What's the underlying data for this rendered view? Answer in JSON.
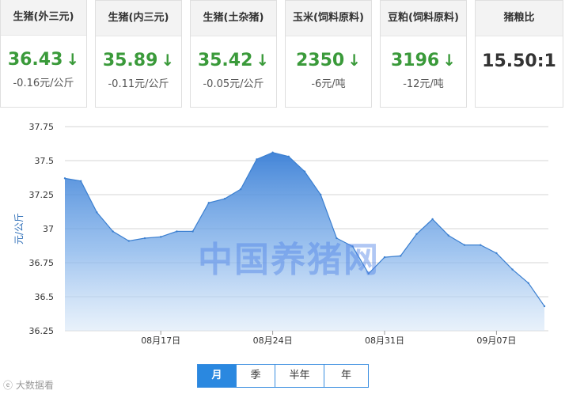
{
  "cards": [
    {
      "title": "生猪(外三元)",
      "value": "36.43",
      "change": "-0.16元/公斤"
    },
    {
      "title": "生猪(内三元)",
      "value": "35.89",
      "change": "-0.11元/公斤"
    },
    {
      "title": "生猪(土杂猪)",
      "value": "35.42",
      "change": "-0.05元/公斤"
    },
    {
      "title": "玉米(饲料原料)",
      "value": "2350",
      "change": "-6元/吨"
    },
    {
      "title": "豆粕(饲料原料)",
      "value": "3196",
      "change": "-12元/吨"
    },
    {
      "title": "猪粮比",
      "value": "15.50:1",
      "change": ""
    }
  ],
  "arrow_glyph": "↓",
  "watermark": "中国养猪网",
  "range_buttons": {
    "month": "月",
    "quarter": "季",
    "half_year": "半年",
    "year": "年"
  },
  "corner_text": "大数据看",
  "colors": {
    "accent": "#2a88e0",
    "down": "#3a9a3a",
    "line": "#3b7fd0"
  },
  "chart_data": {
    "type": "area",
    "ylabel": "元/公斤",
    "ylim": [
      36.25,
      37.75
    ],
    "yticks": [
      "36.25",
      "36.5",
      "36.75",
      "37",
      "37.25",
      "37.5",
      "37.75"
    ],
    "xtick_labels": [
      "08月17日",
      "08月24日",
      "08月31日",
      "09月07日"
    ],
    "xtick_index": [
      6,
      13,
      20,
      27
    ],
    "grid": true,
    "values": [
      37.37,
      37.35,
      37.12,
      36.98,
      36.91,
      36.93,
      36.94,
      36.98,
      36.98,
      37.19,
      37.22,
      37.29,
      37.51,
      37.56,
      37.53,
      37.42,
      37.25,
      36.93,
      36.87,
      36.67,
      36.79,
      36.8,
      36.96,
      37.07,
      36.95,
      36.88,
      36.88,
      36.82,
      36.7,
      36.6,
      36.43
    ]
  }
}
